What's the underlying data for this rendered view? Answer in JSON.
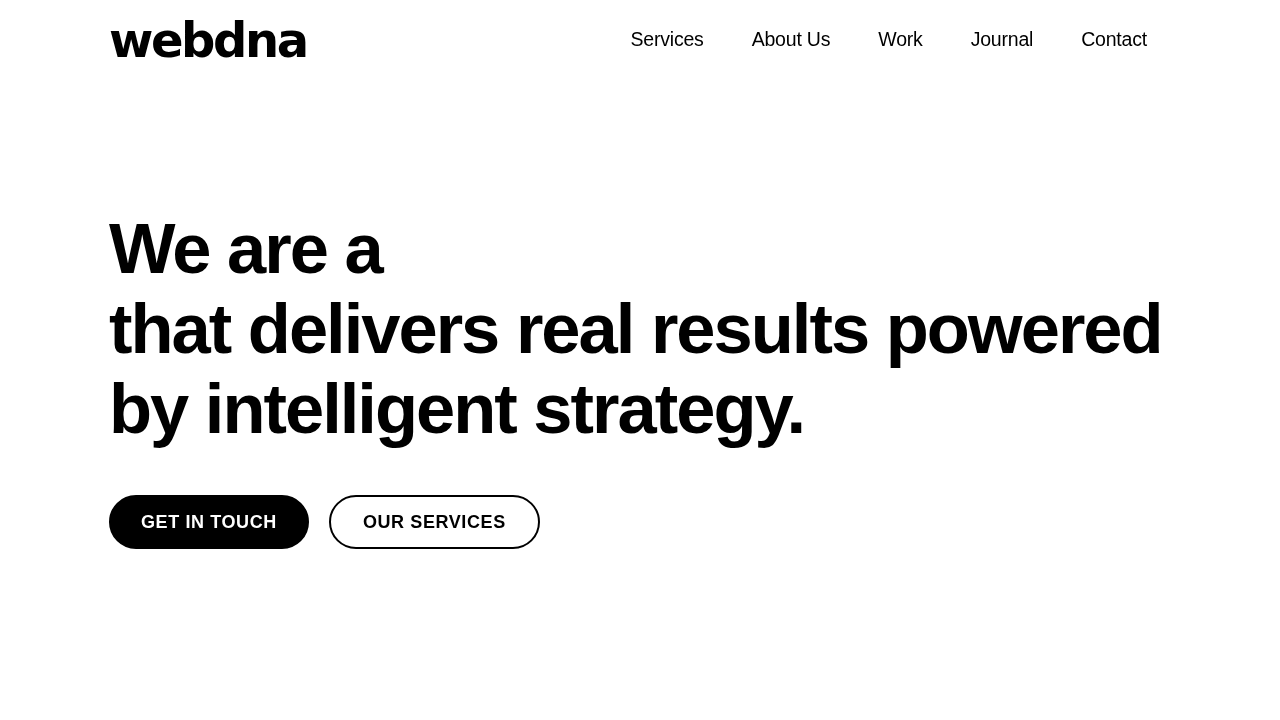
{
  "header": {
    "logo": "webdna",
    "nav": [
      {
        "label": "Services"
      },
      {
        "label": "About Us"
      },
      {
        "label": "Work"
      },
      {
        "label": "Journal"
      },
      {
        "label": "Contact"
      }
    ]
  },
  "hero": {
    "headline_lines": [
      "We are a",
      "that delivers real results powered",
      "by intelligent strategy."
    ],
    "buttons": [
      {
        "label": "GET IN TOUCH",
        "kind": "filled"
      },
      {
        "label": "OUR SERVICES",
        "kind": "outline"
      }
    ]
  }
}
